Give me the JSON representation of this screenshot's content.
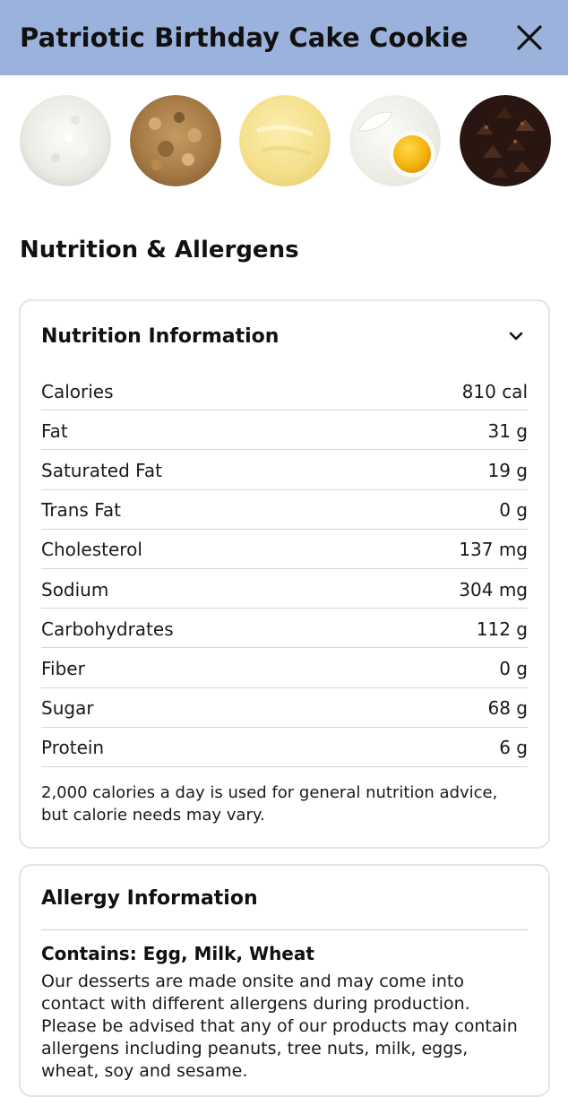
{
  "header": {
    "title": "Patriotic Birthday Cake Cookie",
    "close_icon": "close-icon"
  },
  "ingredients": [
    {
      "name": "flour"
    },
    {
      "name": "brown sugar"
    },
    {
      "name": "butter"
    },
    {
      "name": "egg"
    },
    {
      "name": "chocolate chips"
    }
  ],
  "section_title": "Nutrition & Allergens",
  "nutrition": {
    "title": "Nutrition Information",
    "toggle_icon": "chevron-down-icon",
    "rows": [
      {
        "label": "Calories",
        "value": "810 cal"
      },
      {
        "label": "Fat",
        "value": "31 g"
      },
      {
        "label": "Saturated Fat",
        "value": "19 g"
      },
      {
        "label": "Trans Fat",
        "value": "0 g"
      },
      {
        "label": "Cholesterol",
        "value": "137 mg"
      },
      {
        "label": "Sodium",
        "value": "304 mg"
      },
      {
        "label": "Carbohydrates",
        "value": "112 g"
      },
      {
        "label": "Fiber",
        "value": "0 g"
      },
      {
        "label": "Sugar",
        "value": "68 g"
      },
      {
        "label": "Protein",
        "value": "6 g"
      }
    ],
    "footnote": "2,000 calories a day is used for general nutrition advice, but calorie needs may vary."
  },
  "allergy": {
    "title": "Allergy Information",
    "contains": "Contains: Egg, Milk, Wheat",
    "text": "Our desserts are made onsite and may come into contact with different allergens during production. Please be advised that any of our products may contain allergens including peanuts, tree nuts, milk, eggs, wheat, soy and sesame."
  },
  "colors": {
    "header_bg": "#9bb3dc",
    "border": "#e4e4e4"
  }
}
